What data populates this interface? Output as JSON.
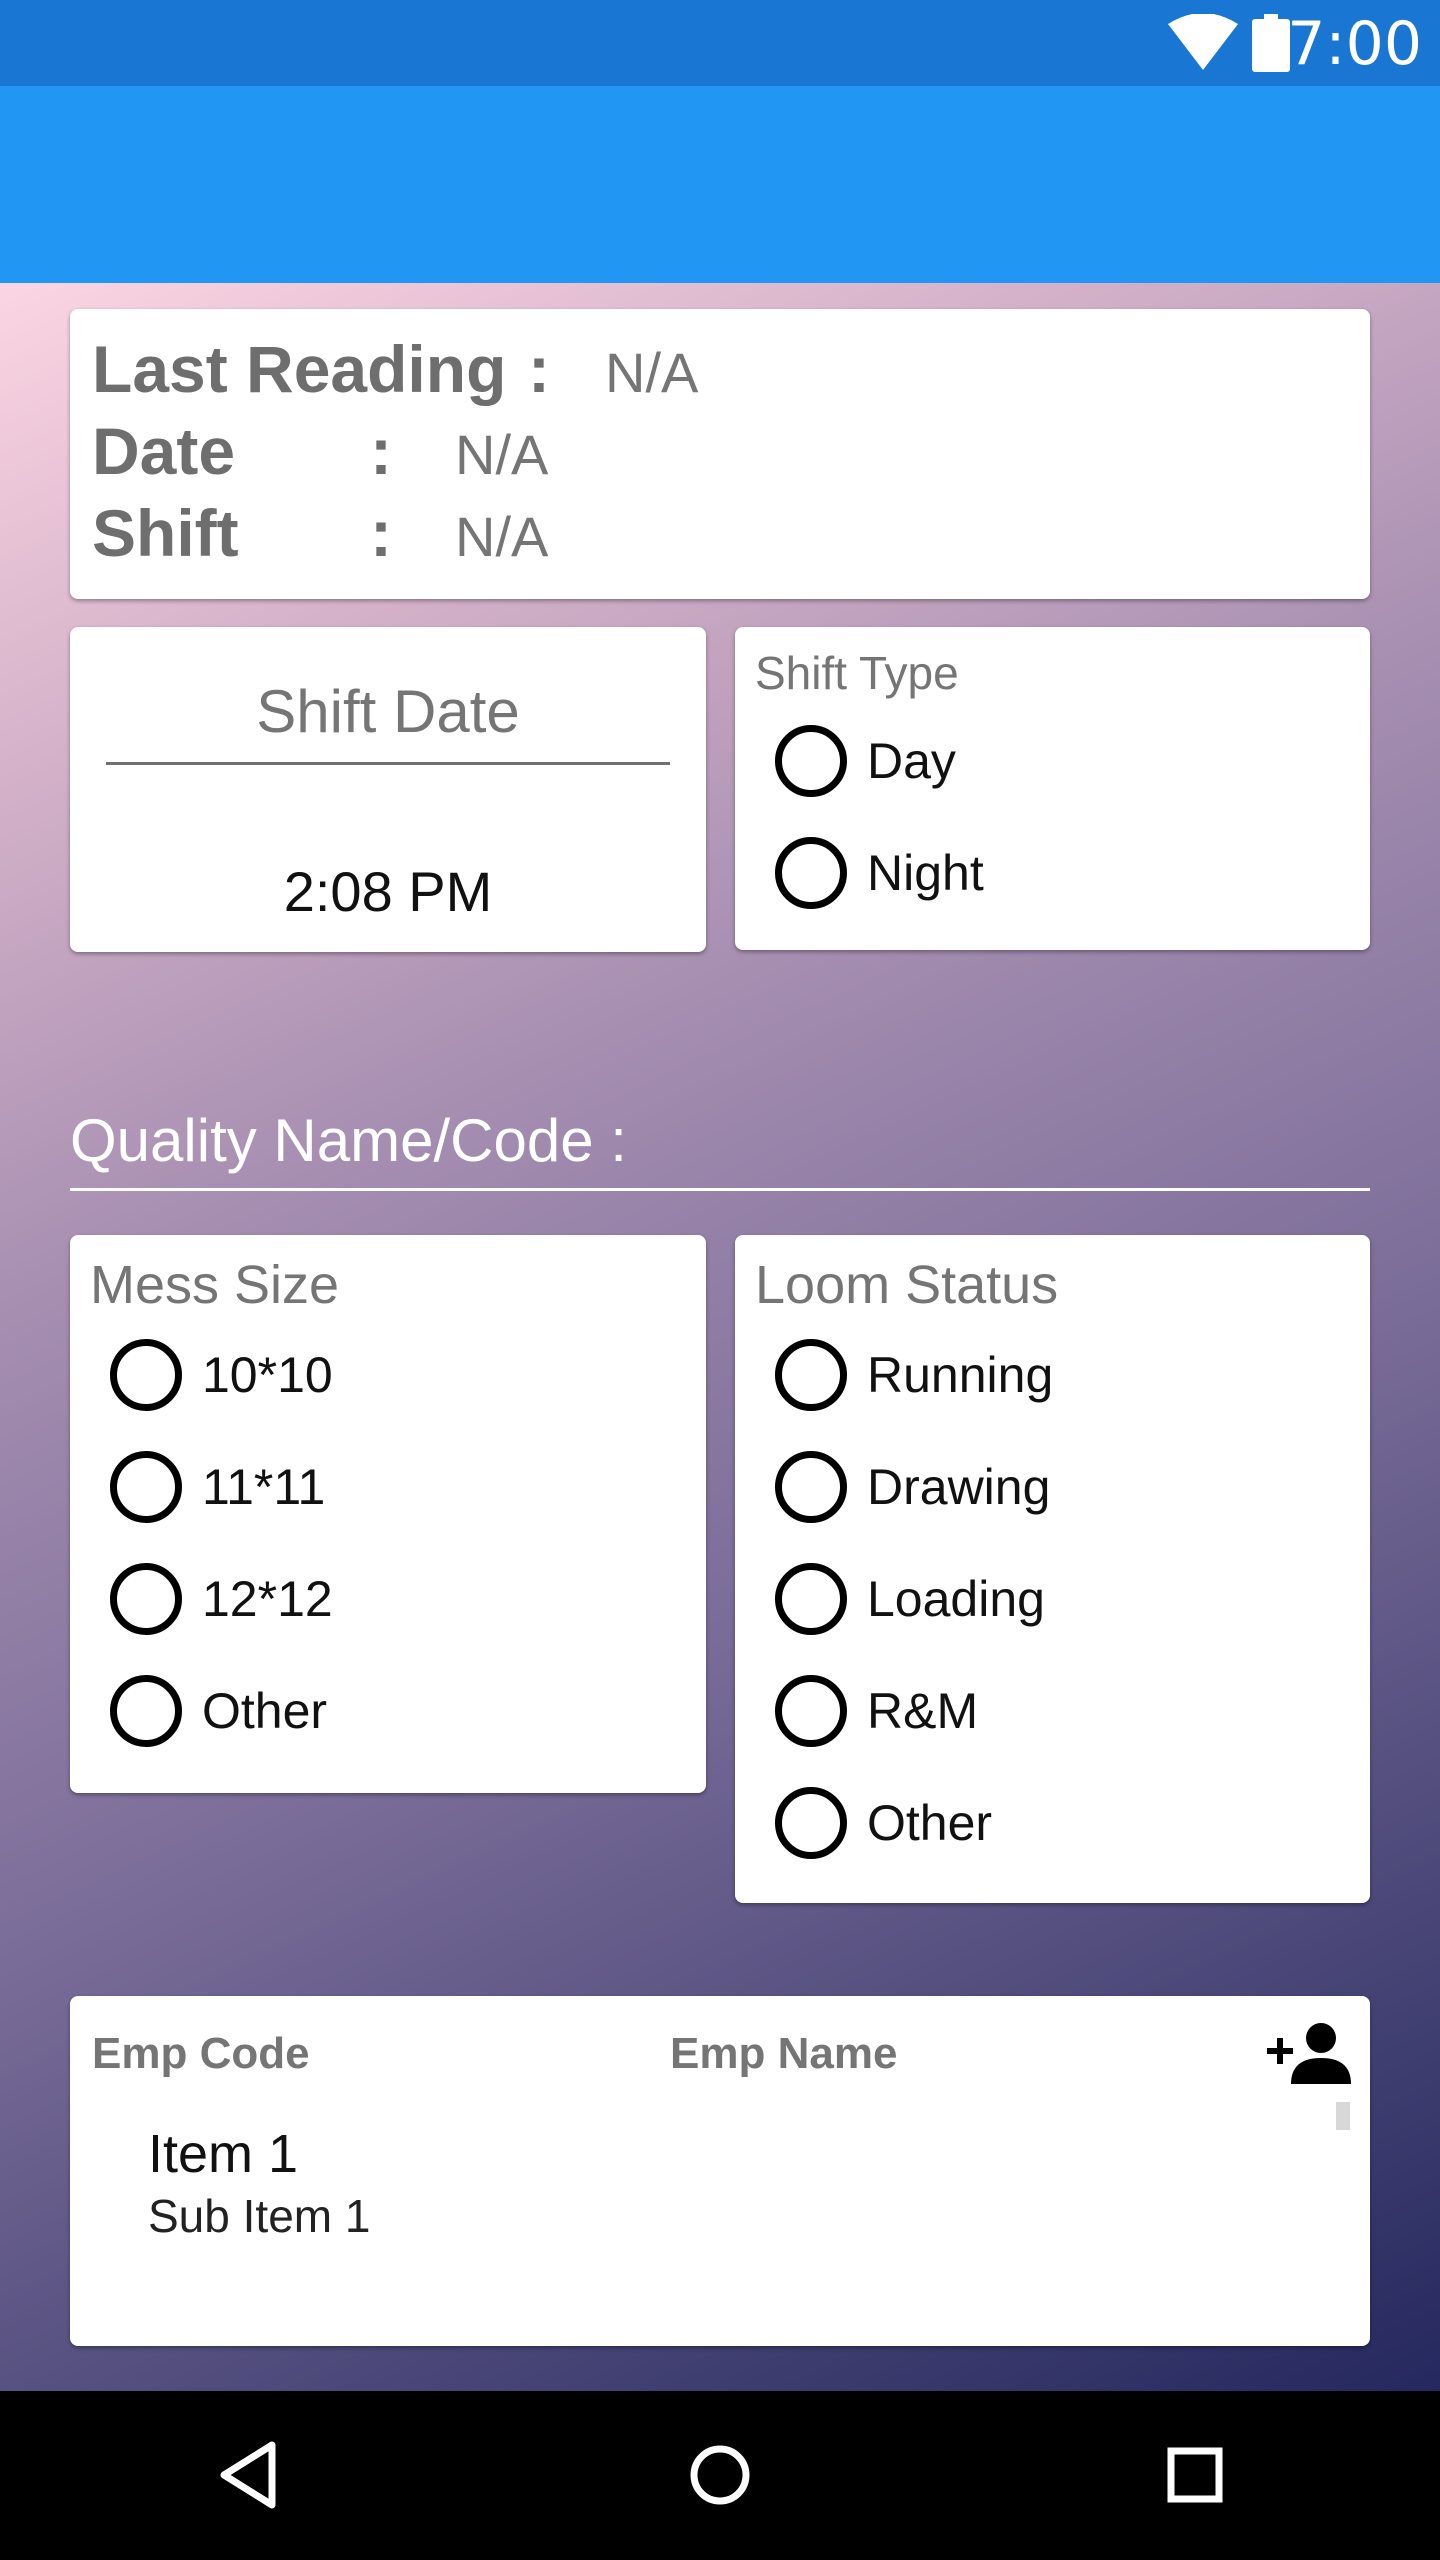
{
  "status_bar": {
    "time": "7:00",
    "icons": [
      "wifi-icon",
      "battery-icon"
    ],
    "background": "#1976D2"
  },
  "app_bar": {
    "background": "#2196F3"
  },
  "last_reading": {
    "last_reading_label": "Last Reading",
    "last_reading_value": "N/A",
    "date_label": "Date",
    "date_value": "N/A",
    "shift_label": "Shift",
    "shift_value": "N/A",
    "separator": ":"
  },
  "shift_date": {
    "title": "Shift Date",
    "time": "2:08 PM"
  },
  "shift_type": {
    "title": "Shift Type",
    "options": [
      "Day",
      "Night"
    ]
  },
  "quality": {
    "label": "Quality Name/Code :"
  },
  "mess_size": {
    "title": "Mess Size",
    "options": [
      "10*10",
      "11*11",
      "12*12",
      "Other"
    ]
  },
  "loom_status": {
    "title": "Loom Status",
    "options": [
      "Running",
      "Drawing",
      "Loading",
      "R&M",
      "Other"
    ]
  },
  "employees": {
    "col_code": "Emp Code",
    "col_name": "Emp Name",
    "add_icon": "add-person-icon",
    "items": [
      {
        "title": "Item 1",
        "subtitle": "Sub Item 1"
      }
    ]
  },
  "nav_bar": {
    "icons": [
      "back-icon",
      "home-icon",
      "recent-apps-icon"
    ]
  }
}
